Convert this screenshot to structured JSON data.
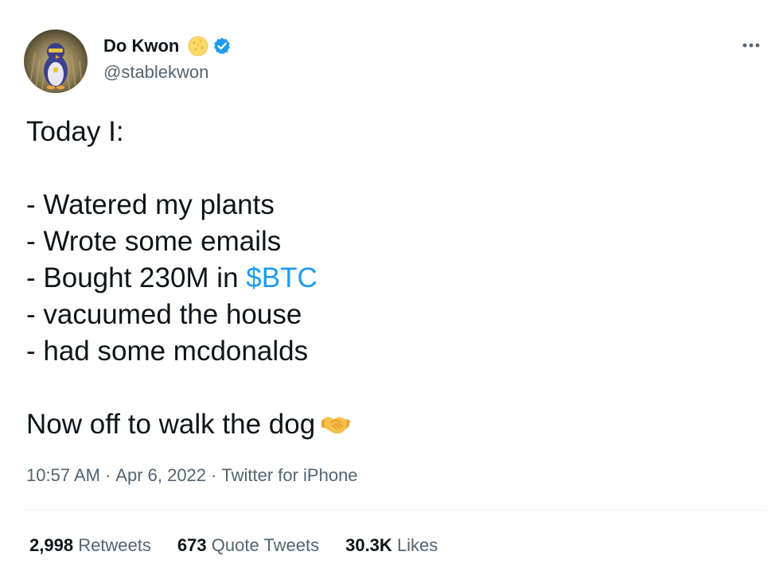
{
  "author": {
    "display_name": "Do Kwon",
    "handle": "@stablekwon",
    "avatar_icon": "penguin-avatar",
    "badge_icon": "cookie-icon",
    "verified_icon": "verified-badge-icon"
  },
  "tweet": {
    "lines": [
      "Today I:",
      "",
      "- Watered my plants",
      "- Wrote some emails",
      "- Bought 230M in ",
      "- vacuumed the house",
      "- had some mcdonalds",
      "",
      "Now off to walk the dog"
    ],
    "cashtag": "$BTC",
    "end_emoji": "handshake-icon"
  },
  "meta": {
    "time": "10:57 AM",
    "separator": "·",
    "date": "Apr 6, 2022",
    "source": "Twitter for iPhone"
  },
  "stats": {
    "retweets_count": "2,998",
    "retweets_label": "Retweets",
    "quotes_count": "673",
    "quotes_label": "Quote Tweets",
    "likes_count": "30.3K",
    "likes_label": "Likes"
  },
  "colors": {
    "text": "#0f1419",
    "secondary": "#536471",
    "link": "#1d9bf0",
    "verified": "#1d9bf0",
    "divider": "#eff3f4"
  }
}
